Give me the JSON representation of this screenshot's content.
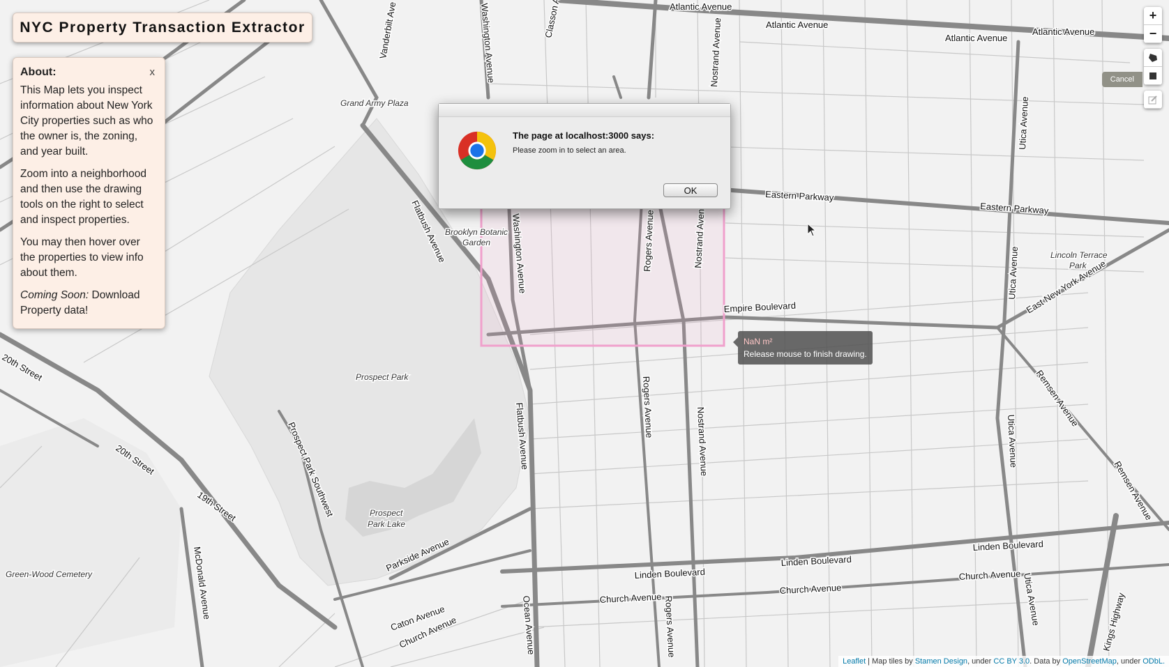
{
  "app": {
    "title": "NYC Property Transaction Extractor"
  },
  "about": {
    "heading": "About:",
    "close_label": "x",
    "para1": "This Map lets you inspect information about New York City properties such as who the owner is, the zoning, and year built.",
    "para2": "Zoom into a neighborhood and then use the drawing tools on the right to select and inspect properties.",
    "para3": "You may then hover over the properties to view info about them.",
    "para4_em": "Coming Soon:",
    "para4_rest": " Download Property data!"
  },
  "controls": {
    "zoom_in": "+",
    "zoom_out": "−",
    "cancel": "Cancel",
    "draw_tools": [
      "polygon-icon",
      "rectangle-icon",
      "edit-icon"
    ]
  },
  "draw_tooltip": {
    "area": "NaN m²",
    "hint": "Release mouse to finish drawing."
  },
  "alert": {
    "title": "The page at localhost:3000 says:",
    "message": "Please zoom in to select an area.",
    "ok_label": "OK"
  },
  "map": {
    "streets": {
      "atlantic": "Atlantic Avenue",
      "eastern": "Eastern Parkway",
      "empire": "Empire Boulevard",
      "linden": "Linden Boulevard",
      "church": "Church Avenue",
      "flatbush": "Flatbush Avenue",
      "washington": "Washington Avenue",
      "rogers": "Rogers Avenue",
      "nostrand": "Nostrand Avenue",
      "utica": "Utica Avenue",
      "ocean": "Ocean Avenue",
      "vanderbilt": "Vanderbilt Ave",
      "classon": "Classon Ave",
      "eastny": "East New York Avenue",
      "remsen": "Remsen Avenue",
      "kings": "Kings Highway",
      "parkside": "Parkside Avenue",
      "caton": "Caton Avenue",
      "ppsw": "Prospect Park Southwest",
      "mcdonald": "McDonald Avenue",
      "st20": "20th Street",
      "st19": "19th Street"
    },
    "places": {
      "grand_army": "Grand Army Plaza",
      "botanic_1": "Brooklyn Botanic",
      "botanic_2": "Garden",
      "prospect_park": "Prospect Park",
      "lake_1": "Prospect",
      "lake_2": "Park Lake",
      "greenwood": "Green-Wood Cemetery",
      "lincoln_1": "Lincoln Terrace",
      "lincoln_2": "Park"
    }
  },
  "attribution": {
    "leaflet": "Leaflet",
    "sep1": " | Map tiles by ",
    "stamen": "Stamen Design",
    "sep2": ", under ",
    "ccby": "CC BY 3.0",
    "sep3": ". Data by ",
    "osm": "OpenStreetMap",
    "sep4": ", under ",
    "odbl": "ODbL."
  },
  "colors": {
    "panel_bg": "#fdefe6",
    "selection": "#f09cc8",
    "link": "#0078a8"
  }
}
